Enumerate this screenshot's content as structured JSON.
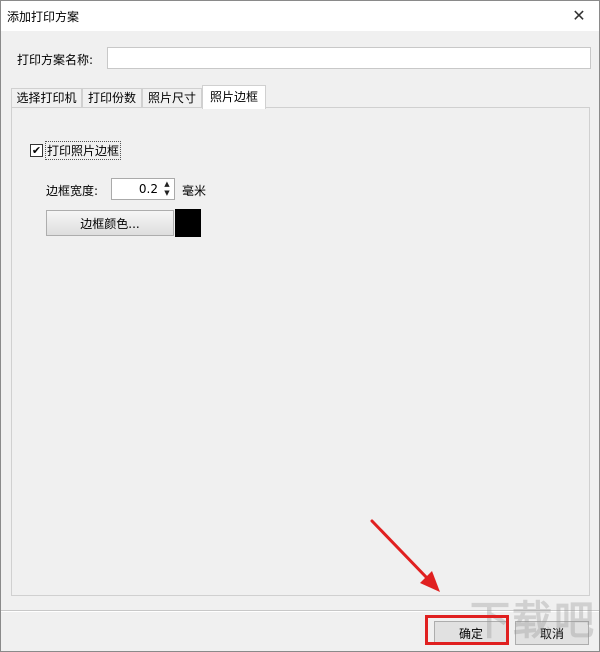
{
  "window": {
    "title": "添加打印方案",
    "close_glyph": "✕"
  },
  "scheme_name": {
    "label": "打印方案名称:",
    "value": "",
    "placeholder": ""
  },
  "tabs": [
    {
      "label": "选择打印机",
      "active": false
    },
    {
      "label": "打印份数",
      "active": false
    },
    {
      "label": "照片尺寸",
      "active": false
    },
    {
      "label": "照片边框",
      "active": true
    }
  ],
  "border_tab": {
    "print_border": {
      "label": "打印照片边框",
      "checked": true,
      "check_glyph": "✔"
    },
    "border_width": {
      "label": "边框宽度:",
      "value": "0.2",
      "unit": "毫米"
    },
    "color_button_label": "边框颜色...",
    "border_color": "#000000"
  },
  "footer": {
    "ok_label": "确定",
    "cancel_label": "取消"
  },
  "annotation": {
    "arrow_color": "#e02020",
    "highlight_color": "#e02020"
  },
  "watermark": "下载吧"
}
